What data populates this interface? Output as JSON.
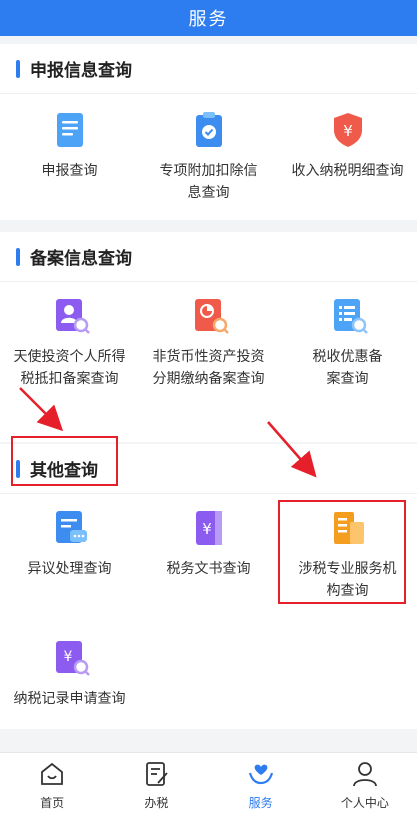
{
  "header": {
    "title": "服务"
  },
  "sections": [
    {
      "title": "申报信息查询",
      "items": [
        {
          "label": "申报查询",
          "icon": "document-icon"
        },
        {
          "label": "专项附加扣除信息查询",
          "icon": "clipboard-check-icon"
        },
        {
          "label": "收入纳税明细查询",
          "icon": "yen-shield-icon"
        }
      ]
    },
    {
      "title": "备案信息查询",
      "items": [
        {
          "label": "天使投资个人所得税抵扣备案查询",
          "icon": "person-search-icon"
        },
        {
          "label": "非货币性资产投资分期缴纳备案查询",
          "icon": "pie-search-icon"
        },
        {
          "label": "税收优惠备案查询",
          "icon": "list-search-icon"
        }
      ]
    },
    {
      "title": "其他查询",
      "items": [
        {
          "label": "异议处理查询",
          "icon": "chat-document-icon"
        },
        {
          "label": "税务文书查询",
          "icon": "yen-book-icon"
        },
        {
          "label": "涉税专业服务机构查询",
          "icon": "building-icon"
        },
        {
          "label": "纳税记录申请查询",
          "icon": "yen-search-icon"
        }
      ]
    }
  ],
  "tabs": [
    {
      "label": "首页",
      "icon": "home-icon",
      "active": false
    },
    {
      "label": "办税",
      "icon": "edit-document-icon",
      "active": false
    },
    {
      "label": "服务",
      "icon": "heart-hands-icon",
      "active": true
    },
    {
      "label": "个人中心",
      "icon": "user-icon",
      "active": false
    }
  ],
  "colors": {
    "accent": "#2d7cf0",
    "annotation": "#e5202b"
  }
}
